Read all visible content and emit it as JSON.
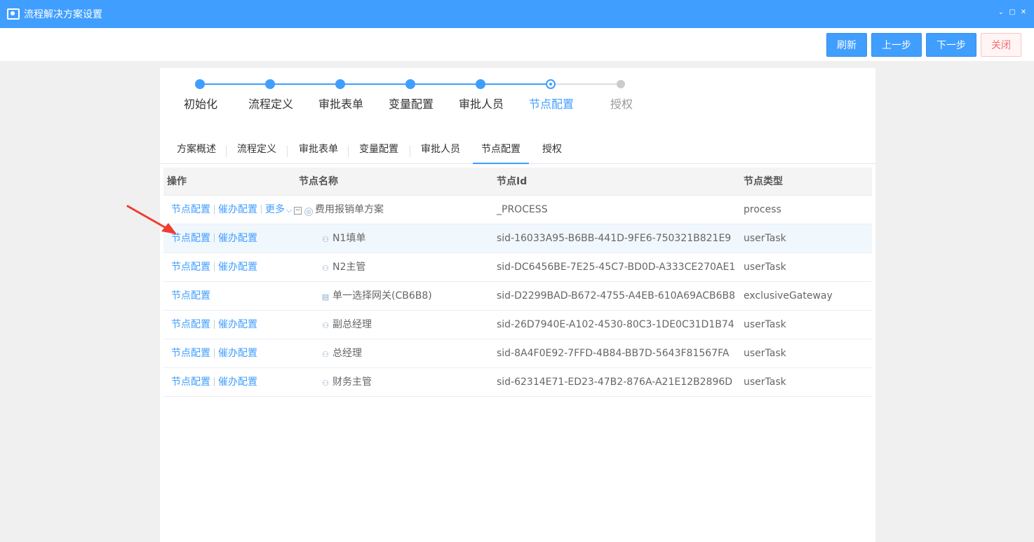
{
  "window": {
    "title": "流程解决方案设置",
    "controls": [
      "minimize-icon",
      "maximize-icon",
      "close-icon"
    ]
  },
  "toolbar": {
    "refresh": "刷新",
    "prev": "上一步",
    "next": "下一步",
    "close": "关闭"
  },
  "steps": [
    {
      "label": "初始化",
      "state": "done"
    },
    {
      "label": "流程定义",
      "state": "done"
    },
    {
      "label": "审批表单",
      "state": "done"
    },
    {
      "label": "变量配置",
      "state": "done"
    },
    {
      "label": "审批人员",
      "state": "done"
    },
    {
      "label": "节点配置",
      "state": "current"
    },
    {
      "label": "授权",
      "state": "pending"
    }
  ],
  "tabs": [
    {
      "label": "方案概述"
    },
    {
      "label": "流程定义"
    },
    {
      "label": "审批表单"
    },
    {
      "label": "变量配置"
    },
    {
      "label": "审批人员"
    },
    {
      "label": "节点配置",
      "active": true
    },
    {
      "label": "授权"
    }
  ],
  "table": {
    "headers": {
      "ops": "操作",
      "name": "节点名称",
      "id": "节点Id",
      "type": "节点类型"
    },
    "ops": {
      "node_config": "节点配置",
      "urge_config": "催办配置",
      "more": "更多"
    },
    "root_toggle": "−",
    "rows": [
      {
        "name": "费用报销单方案",
        "id": "_PROCESS",
        "type": "process",
        "icon": "process-icon"
      },
      {
        "name": "N1填单",
        "id": "sid-16033A95-B6BB-441D-9FE6-750321B821E9",
        "type": "userTask",
        "icon": "user-icon"
      },
      {
        "name": "N2主管",
        "id": "sid-DC6456BE-7E25-45C7-BD0D-A333CE270AE1",
        "type": "userTask",
        "icon": "user-icon"
      },
      {
        "name": "单一选择网关(CB6B8)",
        "id": "sid-D2299BAD-B672-4755-A4EB-610A69ACB6B8",
        "type": "exclusiveGateway",
        "icon": "gateway-icon"
      },
      {
        "name": "副总经理",
        "id": "sid-26D7940E-A102-4530-80C3-1DE0C31D1B74",
        "type": "userTask",
        "icon": "user-icon"
      },
      {
        "name": "总经理",
        "id": "sid-8A4F0E92-7FFD-4B84-BB7D-5643F81567FA",
        "type": "userTask",
        "icon": "user-icon"
      },
      {
        "name": "财务主管",
        "id": "sid-62314E71-ED23-47B2-876A-A21E12B2896D",
        "type": "userTask",
        "icon": "user-icon"
      }
    ]
  },
  "colors": {
    "accent": "#409eff",
    "annotation_arrow": "#f03c2e"
  }
}
